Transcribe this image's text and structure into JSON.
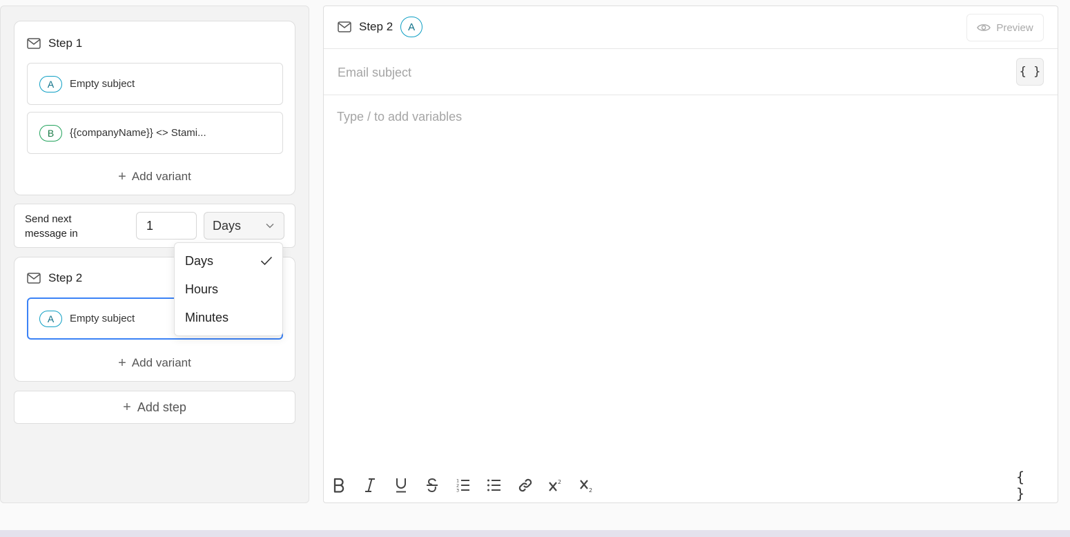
{
  "sequence": {
    "steps": [
      {
        "title": "Step 1",
        "variants": [
          {
            "badge": "A",
            "subject": "Empty subject"
          },
          {
            "badge": "B",
            "subject": "{{companyName}} <> Stami..."
          }
        ],
        "add_variant_label": "Add variant"
      },
      {
        "title": "Step 2",
        "variants": [
          {
            "badge": "A",
            "subject": "Empty subject"
          }
        ],
        "add_variant_label": "Add variant"
      }
    ],
    "delay": {
      "label": "Send next message in",
      "value": "1",
      "unit": "Days"
    },
    "unit_options": [
      {
        "label": "Days",
        "selected": true
      },
      {
        "label": "Hours",
        "selected": false
      },
      {
        "label": "Minutes",
        "selected": false
      }
    ],
    "add_step_label": "Add step"
  },
  "editor": {
    "title": "Step 2",
    "variant_badge": "A",
    "preview_label": "Preview",
    "subject_placeholder": "Email subject",
    "variables_label": "{ }",
    "body_placeholder": "Type / to add variables"
  },
  "toolbar": {
    "tools": [
      "bold-icon",
      "italic-icon",
      "underline-icon",
      "strikethrough-icon",
      "ordered-list-icon",
      "bullet-list-icon",
      "link-icon",
      "superscript-icon",
      "subscript-icon"
    ],
    "variables_label": "{ }"
  },
  "colors": {
    "accent": "#3b82f6",
    "badge_a": "#0e9fc4",
    "badge_b": "#22a35c"
  }
}
